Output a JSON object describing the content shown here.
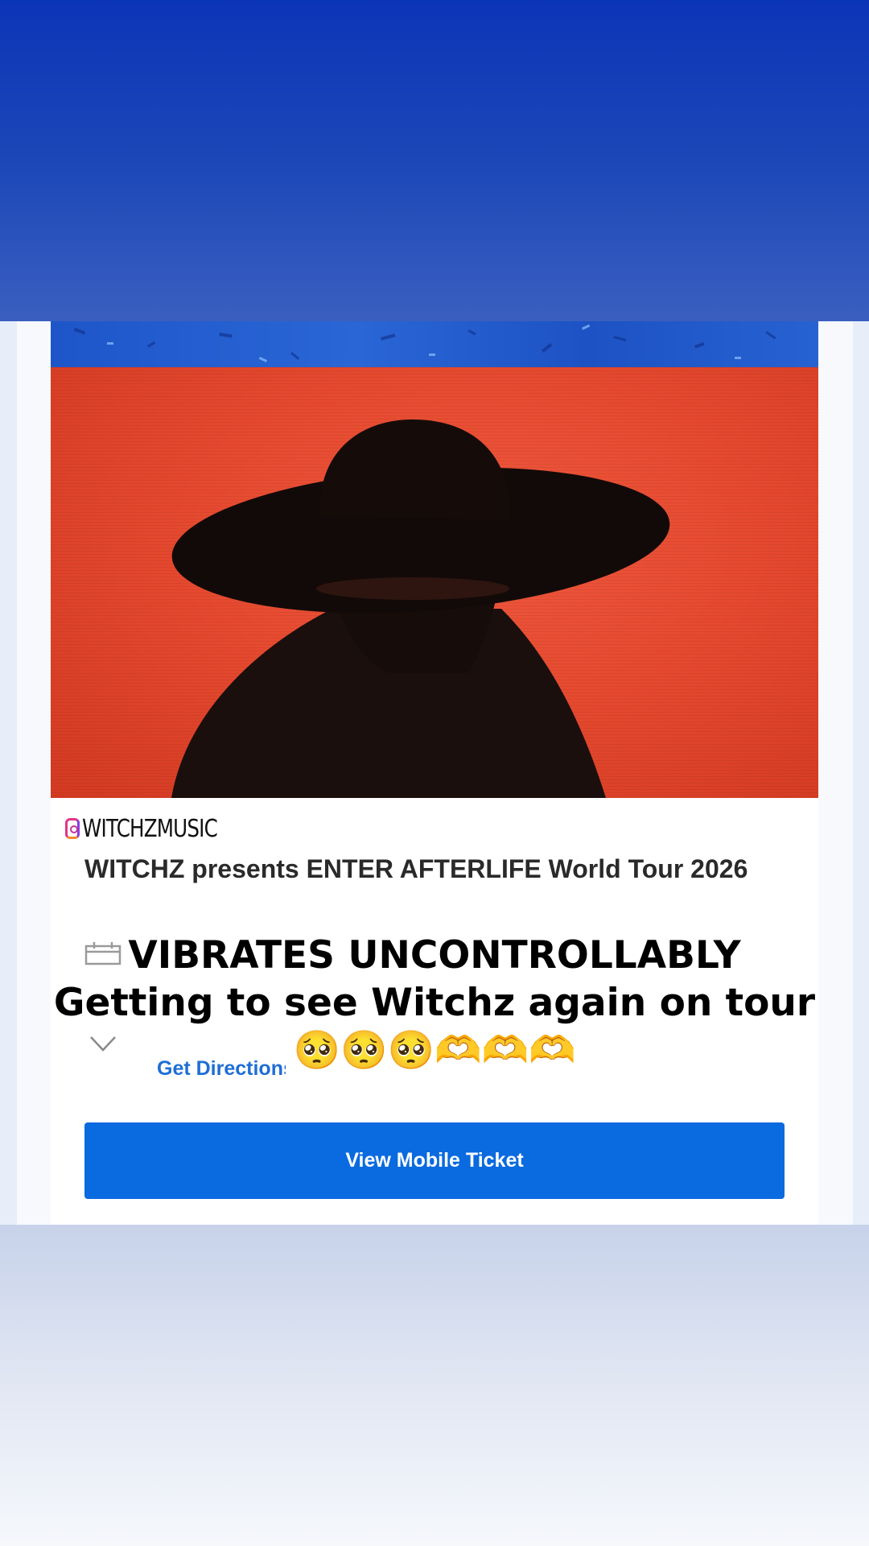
{
  "event": {
    "instagram_handle": "WITCHZMUSIC",
    "title": "WITCHZ presents ENTER AFTERLIFE World Tour 2026",
    "get_directions_label": "Get Directions",
    "view_ticket_label": "View Mobile Ticket"
  },
  "overlay": {
    "line1": "VIBRATES UNCONTROLLABLY",
    "line2": "Getting to see Witchz again on tour",
    "line3": "🥺🥺🥺🫶🫶🫶"
  },
  "colors": {
    "top_band": "#0b35b7",
    "hero_background": "#e64a2f",
    "button": "#0a6ae0",
    "link": "#1f6ed4"
  },
  "icons": [
    "instagram-icon",
    "calendar-icon",
    "chevron-down-icon"
  ]
}
